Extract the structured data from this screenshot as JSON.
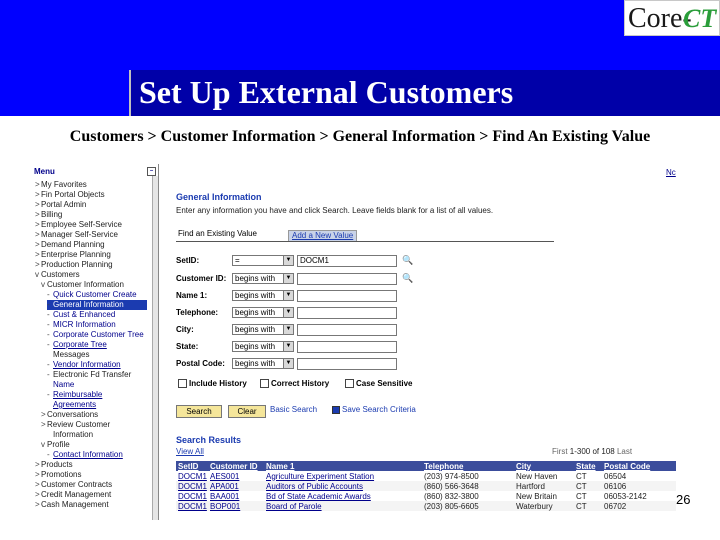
{
  "header": {
    "logo_core": "Core-",
    "logo_ct": "CT",
    "title": "Set Up External Customers"
  },
  "breadcrumb": "Customers > Customer Information > General Information > Find An Existing Value",
  "menu": {
    "title": "Menu",
    "minimize_icon": "minimize-icon",
    "items": [
      {
        "label": "My Favorites"
      },
      {
        "label": "Fin Portal Objects"
      },
      {
        "label": "Portal Admin"
      },
      {
        "label": "Billing"
      },
      {
        "label": "Employee Self-Service"
      },
      {
        "label": "Manager Self-Service"
      },
      {
        "label": "Demand Planning"
      },
      {
        "label": "Enterprise Planning"
      },
      {
        "label": "Production Planning"
      },
      {
        "label": "Customers"
      },
      {
        "label": "Customer Information"
      },
      {
        "label": "Quick Customer Create"
      },
      {
        "label": "General Information"
      },
      {
        "label": "Cust & Enhanced"
      },
      {
        "label": "MICR Information"
      },
      {
        "label": "Corporate Customer Tree"
      },
      {
        "label": "Corporate Tree"
      },
      {
        "label": "Messages"
      },
      {
        "label": "Vendor Information"
      },
      {
        "label": "Electronic Fd Transfer"
      },
      {
        "label": "Name"
      },
      {
        "label": "Reimbursable"
      },
      {
        "label": "Agreements"
      },
      {
        "label": "Conversations"
      },
      {
        "label": "Review Customer"
      },
      {
        "label": "Information"
      },
      {
        "label": "Profile"
      },
      {
        "label": "Contact Information"
      },
      {
        "label": "Products"
      },
      {
        "label": "Promotions"
      },
      {
        "label": "Customer Contracts"
      },
      {
        "label": "Credit Management"
      },
      {
        "label": "Cash Management"
      }
    ]
  },
  "page": {
    "corner_link": "Nc",
    "heading": "General Information",
    "instructions": "Enter any information you have and click Search. Leave fields blank for a list of all values.",
    "tab_find": "Find an Existing Value",
    "tab_add": "Add a New Value",
    "fields": [
      {
        "label": "SetID:",
        "operator": "=",
        "value": "DOCM1",
        "has_lookup": true
      },
      {
        "label": "Customer ID:",
        "operator": "begins with",
        "value": "",
        "has_lookup": true
      },
      {
        "label": "Name 1:",
        "operator": "begins with",
        "value": "",
        "has_lookup": false
      },
      {
        "label": "Telephone:",
        "operator": "begins with",
        "value": "",
        "has_lookup": false
      },
      {
        "label": "City:",
        "operator": "begins with",
        "value": "",
        "has_lookup": false
      },
      {
        "label": "State:",
        "operator": "begins with",
        "value": "",
        "has_lookup": false
      },
      {
        "label": "Postal Code:",
        "operator": "begins with",
        "value": "",
        "has_lookup": false
      }
    ],
    "checks": {
      "include_history": "Include History",
      "correct_history": "Correct History",
      "case_sensitive": "Case Sensitive"
    },
    "buttons": {
      "search": "Search",
      "clear": "Clear",
      "basic_search": "Basic Search",
      "save_criteria": "Save Search Criteria"
    },
    "results": {
      "title": "Search Results",
      "view_all": "View All",
      "first": "First",
      "count": "1-300 of 108",
      "last": "Last",
      "columns": [
        "SetID",
        "Customer ID",
        "Name 1",
        "Telephone",
        "City",
        "State",
        "Postal Code"
      ],
      "rows": [
        [
          "DOCM1",
          "AES001",
          "Agriculture Experiment Station",
          "(203) 974-8500",
          "New Haven",
          "CT",
          "06504"
        ],
        [
          "DOCM1",
          "APA001",
          "Auditors of Public Accounts",
          "(860) 566-3648",
          "Hartford",
          "CT",
          "06106"
        ],
        [
          "DOCM1",
          "BAA001",
          "Bd of State Academic Awards",
          "(860) 832-3800",
          "New Britain",
          "CT",
          "06053-2142"
        ],
        [
          "DOCM1",
          "BOP001",
          "Board of Parole",
          "(203) 805-6605",
          "Waterbury",
          "CT",
          "06702"
        ]
      ]
    }
  },
  "page_number": "26",
  "colors": {
    "banner": "#0000ff",
    "title_bg": "#0000a8",
    "link": "#00008b",
    "grid_header": "#3b4d9c",
    "button": "#f5e69a"
  }
}
